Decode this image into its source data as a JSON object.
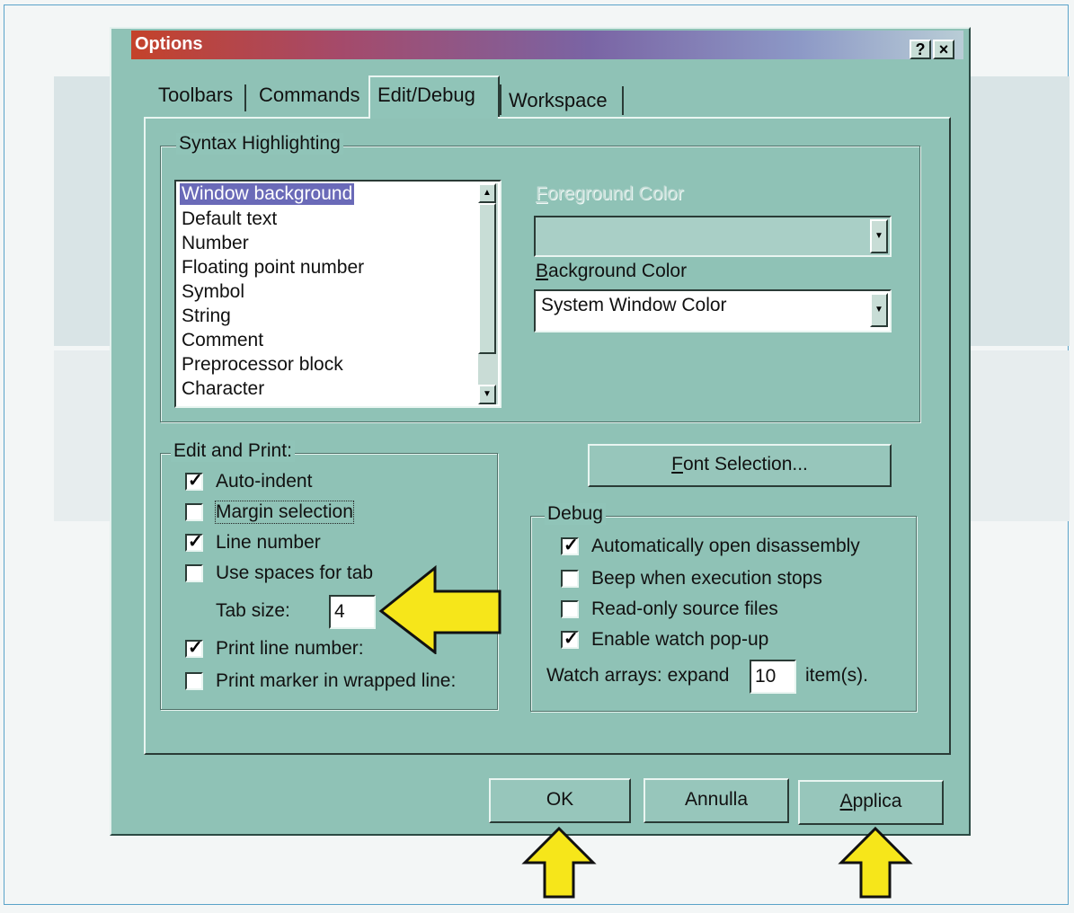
{
  "window": {
    "title": "Options",
    "help_btn": "?",
    "close_btn": "×"
  },
  "tabs": [
    {
      "label": "Toolbars"
    },
    {
      "label": "Commands"
    },
    {
      "label": "Edit/Debug"
    },
    {
      "label": "Workspace"
    }
  ],
  "syntax": {
    "legend": "Syntax Highlighting",
    "items": [
      "Window background",
      "Default text",
      "Number",
      "Floating point number",
      "Symbol",
      "String",
      "Comment",
      "Preprocessor block",
      "Character"
    ],
    "selected": "Window background",
    "foreground_label_first": "F",
    "foreground_label_rest": "oreground Color",
    "foreground_value": "",
    "background_label_first": "B",
    "background_label_rest": "ackground Color",
    "background_value": "System Window Color"
  },
  "edit_print": {
    "legend": "Edit and Print:",
    "auto_indent": "Auto-indent",
    "margin_selection": "Margin selection",
    "line_number": "Line number",
    "use_spaces": "Use spaces for tab",
    "tab_size_label": "Tab size:",
    "tab_size_value": "4",
    "print_line_number": "Print line number:",
    "print_marker": "Print marker in wrapped line:"
  },
  "font_button": {
    "first": "F",
    "rest": "ont Selection..."
  },
  "debug": {
    "legend": "Debug",
    "auto_disassembly": "Automatically open disassembly",
    "beep": "Beep when execution stops",
    "readonly": "Read-only source files",
    "watch_popup": "Enable watch pop-up",
    "watch_label": "Watch arrays: expand",
    "watch_value": "10",
    "watch_unit": "item(s)."
  },
  "buttons": {
    "ok": "OK",
    "cancel": "Annulla",
    "apply_first": "A",
    "apply_rest": "pplica"
  },
  "colors": {
    "dialog_face": "#8fc2b6",
    "selection": "#6a6ab8",
    "arrow_yellow": "#f6e61a"
  }
}
